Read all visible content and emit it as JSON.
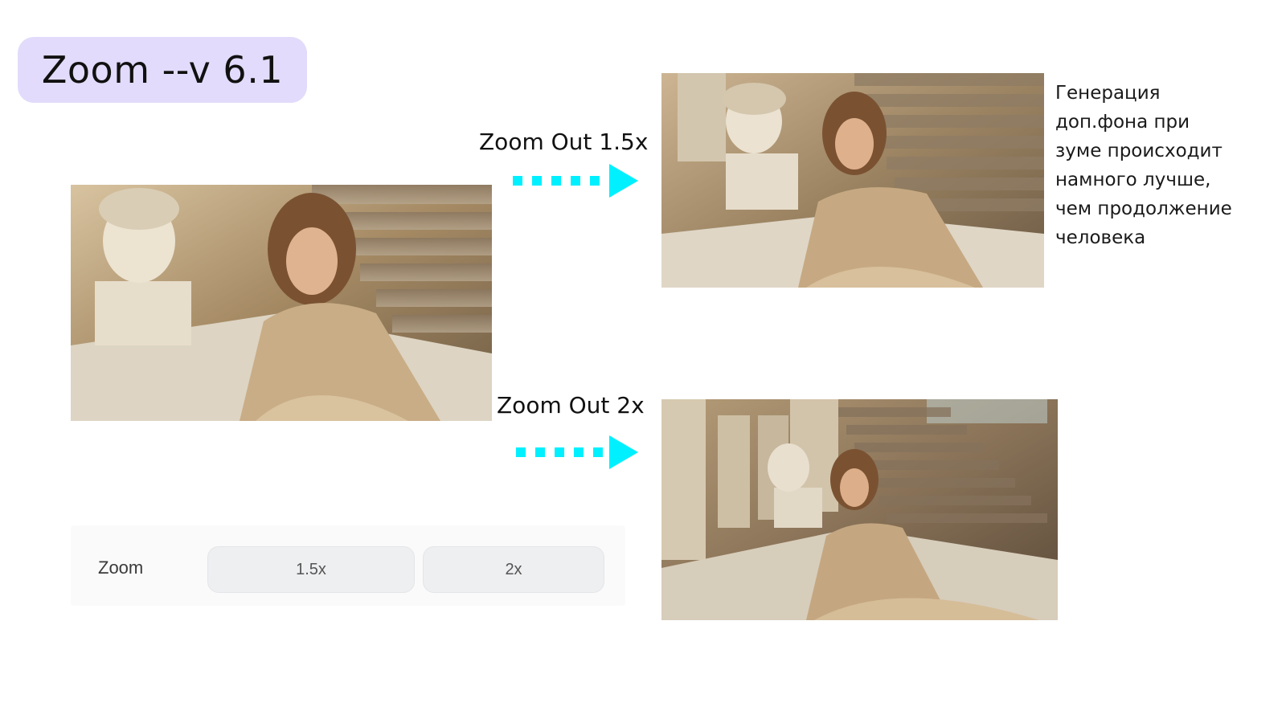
{
  "title": "Zoom --v 6.1",
  "images": {
    "source": "woman-sitting-by-marble-bust-photo",
    "zoom_out_15": "zoomed-out-1.5x-photo",
    "zoom_out_2": "zoomed-out-2x-photo"
  },
  "labels": {
    "zoom_out_15": "Zoom Out 1.5x",
    "zoom_out_2": "Zoom Out 2x"
  },
  "note": "Генерация\nдоп.фона при\nзуме происходит\nнамного лучше,\nчем продолжение\nчеловека",
  "control": {
    "label": "Zoom",
    "options": [
      "1.5x",
      "2x"
    ]
  },
  "colors": {
    "badge": "#e2dbfb",
    "arrow": "#00f0ff"
  }
}
